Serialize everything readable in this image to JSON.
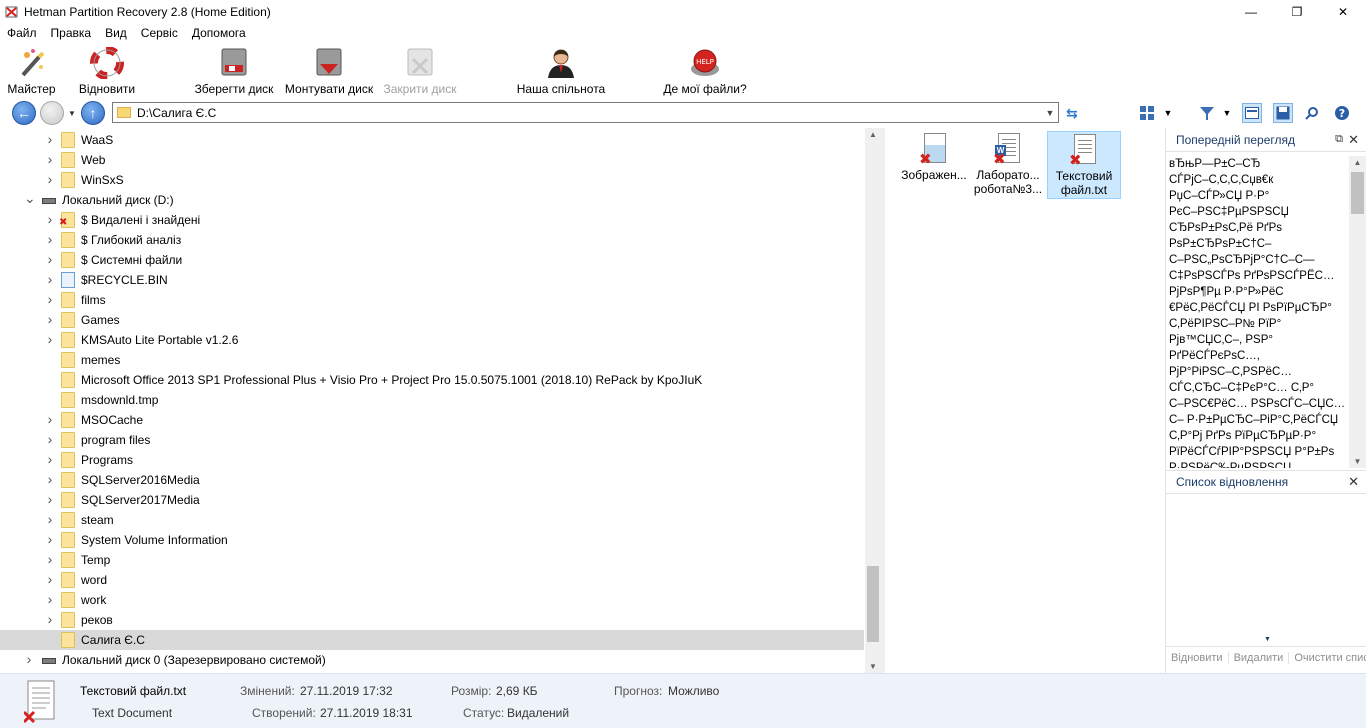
{
  "window": {
    "title": "Hetman Partition Recovery 2.8 (Home Edition)",
    "minimize": "—",
    "maximize": "❐",
    "close": "✕"
  },
  "menu": [
    "Файл",
    "Правка",
    "Вид",
    "Сервіс",
    "Допомога"
  ],
  "toolbar": {
    "wizard": "Майстер",
    "recover": "Відновити",
    "save_disk": "Зберегти диск",
    "mount_disk": "Монтувати диск",
    "close_disk": "Закрити диск",
    "community": "Наша спільнота",
    "where_files": "Де мої файли?"
  },
  "address": {
    "path": "D:\\Салига Є.С"
  },
  "tree": [
    {
      "label": "WaaS",
      "kind": "folder",
      "expander": true
    },
    {
      "label": "Web",
      "kind": "folder",
      "expander": true
    },
    {
      "label": "WinSxS",
      "kind": "folder",
      "expander": true
    },
    {
      "label": "Локальний диск (D:)",
      "kind": "drive",
      "expanded": true
    },
    {
      "label": "$ Видалені і знайдені",
      "kind": "deleted",
      "expander": true
    },
    {
      "label": "$ Глибокий аналіз",
      "kind": "folder",
      "expander": true
    },
    {
      "label": "$ Системні файли",
      "kind": "folder",
      "expander": true
    },
    {
      "label": "$RECYCLE.BIN",
      "kind": "recycle",
      "expander": true
    },
    {
      "label": "films",
      "kind": "folder",
      "expander": true
    },
    {
      "label": "Games",
      "kind": "folder",
      "expander": true
    },
    {
      "label": "KMSAuto Lite Portable v1.2.6",
      "kind": "folder",
      "expander": true
    },
    {
      "label": "memes",
      "kind": "folder",
      "expander": false
    },
    {
      "label": "Microsoft Office 2013 SP1 Professional Plus + Visio Pro + Project Pro 15.0.5075.1001 (2018.10) RePack by KpoJIuK",
      "kind": "folder",
      "expander": false
    },
    {
      "label": "msdownld.tmp",
      "kind": "folder",
      "expander": false
    },
    {
      "label": "MSOCache",
      "kind": "folder",
      "expander": true
    },
    {
      "label": "program files",
      "kind": "folder",
      "expander": true
    },
    {
      "label": "Programs",
      "kind": "folder",
      "expander": true
    },
    {
      "label": "SQLServer2016Media",
      "kind": "folder",
      "expander": true
    },
    {
      "label": "SQLServer2017Media",
      "kind": "folder",
      "expander": true
    },
    {
      "label": "steam",
      "kind": "folder",
      "expander": true
    },
    {
      "label": "System Volume Information",
      "kind": "folder",
      "expander": true
    },
    {
      "label": "Temp",
      "kind": "folder",
      "expander": true
    },
    {
      "label": "word",
      "kind": "folder",
      "expander": true
    },
    {
      "label": "work",
      "kind": "folder",
      "expander": true
    },
    {
      "label": "реков",
      "kind": "folder",
      "expander": true
    },
    {
      "label": "Салига Є.С",
      "kind": "folder",
      "expander": false,
      "selected": true
    },
    {
      "label": "Локальний диск 0 (Зарезервировано системой)",
      "kind": "drive",
      "expanded": false
    }
  ],
  "files": [
    {
      "name": "Зображен...",
      "type": "image"
    },
    {
      "name": "Лаборато... робота№3...",
      "type": "word"
    },
    {
      "name": "Текстовий файл.txt",
      "type": "text",
      "selected": true
    }
  ],
  "preview": {
    "title": "Попередній перегляд",
    "lines": [
      "вЂњР—Р±С–СЂ",
      "СЃРјС–С‚С‚С‚Сџв€к",
      "РџС–СЃР»СЏ Р·Р°",
      "РєС–РЅС‡РµРЅРЅСЏ",
      "СЂРѕР±РѕС‚Рё РґРѕ",
      "РѕР±СЂРѕР±С†С–",
      "С–РЅС„РѕСЂРјР°С†С–С—",
      "С‡РѕРЅСЃРѕ РґРѕРЅСЃРЁС…",
      "РјРѕР¶Рµ Р·Р°Р»РёС",
      "€РёС‚РёСЃСЏ РІ РѕРїРµСЂР°",
      "С‚РёРІРЅС–Р№ РїР°",
      "Рјв™СЏС‚С–, РЅР°",
      "РґРёСЃРєРѕС…,",
      "РјР°РіРЅС–С‚РЅРёС…",
      "СЃС‚СЂС–С‡РєР°С… С‚Р°",
      "С–РЅС€РёС… РЅРѕСЃС–СЏС…",
      "С– Р·Р±РµСЂС–РіР°С‚РёСЃСЏ",
      "С‚Р°Рј РґРѕ РїРµСЂРµР·Р°",
      "РїРёСЃСѓРІР°РЅРЅСЏ Р°Р±Рѕ",
      "Р·РЅРёС‰РµРЅРЅСЏ"
    ]
  },
  "recovery_list": {
    "title": "Список відновлення",
    "actions": [
      "Відновити",
      "Видалити",
      "Очистити список"
    ]
  },
  "status": {
    "file_name": "Текстовий файл.txt",
    "file_type": "Text Document",
    "modified_label": "Змінений:",
    "modified_value": "27.11.2019 17:32",
    "created_label": "Створений:",
    "created_value": "27.11.2019 18:31",
    "size_label": "Розмір:",
    "size_value": "2,69 КБ",
    "state_label": "Статус:",
    "state_value": "Видалений",
    "forecast_label": "Прогноз:",
    "forecast_value": "Можливо"
  }
}
